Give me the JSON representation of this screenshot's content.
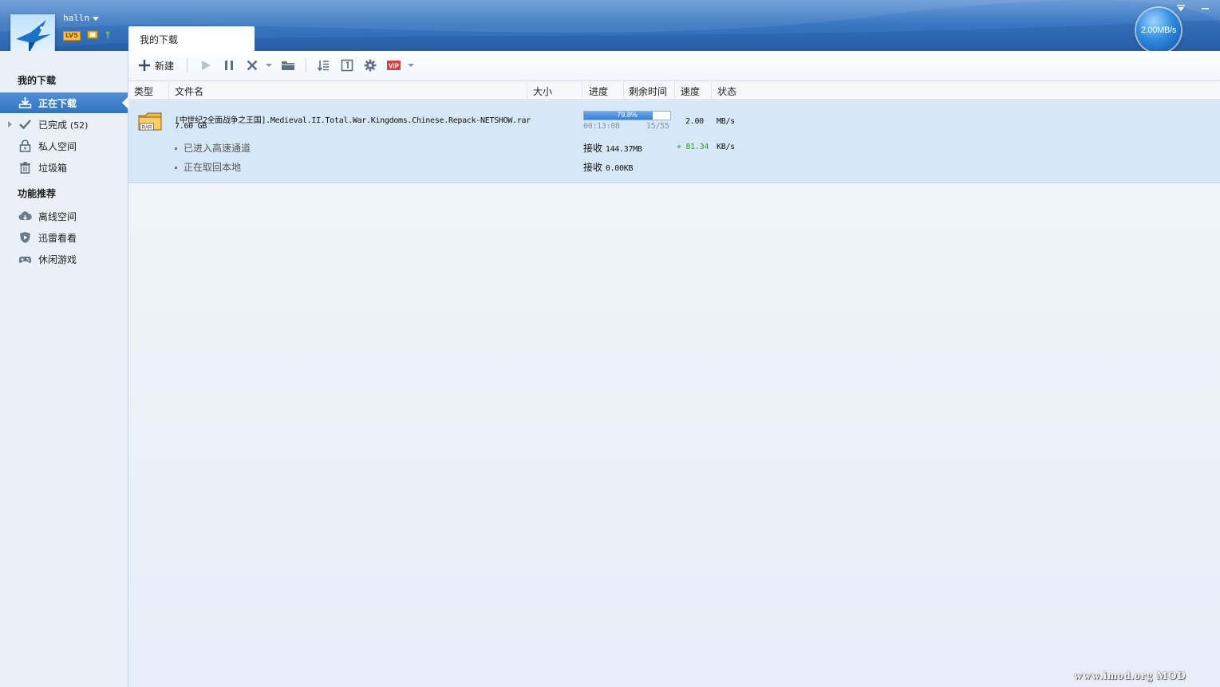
{
  "user": {
    "name": "halln",
    "level": "LV5"
  },
  "speed_indicator": "2.00MB/s",
  "tab": {
    "label": "我的下载"
  },
  "sidebar": {
    "section1": "我的下载",
    "items": [
      {
        "label": "正在下载",
        "icon": "download-icon",
        "active": true
      },
      {
        "label": "已完成",
        "count": "(52)",
        "icon": "checkmark-icon"
      },
      {
        "label": "私人空间",
        "icon": "lock-icon"
      },
      {
        "label": "垃圾箱",
        "icon": "trash-icon"
      }
    ],
    "section2": "功能推荐",
    "features": [
      {
        "label": "离线空间",
        "icon": "cloud-icon"
      },
      {
        "label": "迅雷看看",
        "icon": "video-shield-icon"
      },
      {
        "label": "休闲游戏",
        "icon": "gamepad-icon"
      }
    ]
  },
  "toolbar": {
    "new_label": "新建",
    "icons": [
      "plus-icon",
      "play-icon",
      "pause-icon",
      "delete-icon",
      "folder-icon",
      "sort-icon",
      "page-icon",
      "gear-icon",
      "vip-icon"
    ]
  },
  "columns": {
    "type": "类型",
    "name": "文件名",
    "size": "大小",
    "progress": "进度",
    "remaining": "剩余时间",
    "speed": "速度",
    "status": "状态"
  },
  "task": {
    "filename": "[中世纪2全面战争之王国].Medieval.II.Total.War.Kingdoms.Chinese.Repack-NETSHOW.rar",
    "size": "7.60 GB",
    "file_type": "RAR",
    "progress_fraction": 0.798,
    "progress_label": "79.8%",
    "remaining": "00:13:08",
    "peers": "15/55",
    "speed_value": "2.00",
    "speed_unit": "MB/s",
    "sub1_label": "已进入高速通道",
    "sub1_recv_label": "接收",
    "sub1_recv": "144.37MB",
    "sub1_speed": "+ 81.34",
    "sub1_unit": "KB/s",
    "sub2_label": "正在取回本地",
    "sub2_recv_label": "接收",
    "sub2_recv": "0.00KB"
  },
  "colors": {
    "accent": "#2f72bf",
    "row_bg": "#d6e8f8",
    "speed_green": "#2a9a2a"
  },
  "watermark": "www.imod.org  MOD"
}
